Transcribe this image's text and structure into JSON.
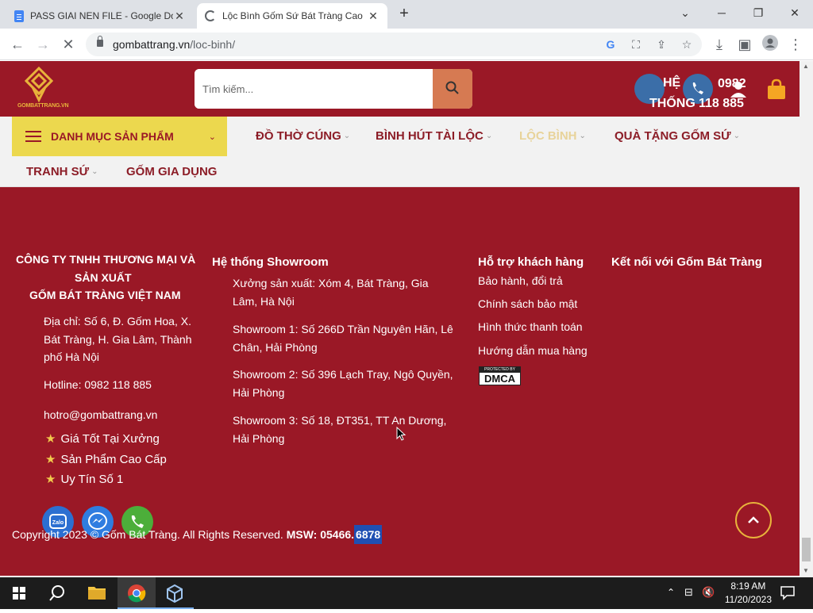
{
  "browser": {
    "tabs": [
      {
        "title": "PASS GIAI NEN FILE - Google Do"
      },
      {
        "title": "Lộc Bình Gốm Sứ Bát Tràng Cao"
      }
    ],
    "url_host": "gombattrang.vn",
    "url_path": "/loc-binh/"
  },
  "header": {
    "logo_text": "GOMBATTRANG.VN",
    "search_placeholder": "Tìm kiếm...",
    "he_label": "HỆ",
    "thong_label": "THỐNG",
    "phone_part1": "0982",
    "phone_part2": "118 885",
    "ghost_label": "HỆ\nTHỐNG"
  },
  "menu": {
    "category_button": "DANH MỤC SẢN PHẨM",
    "items": [
      {
        "label": "ĐỒ THỜ CÚNG"
      },
      {
        "label": "BÌNH HÚT TÀI LỘC"
      },
      {
        "label": "LỘC BÌNH"
      },
      {
        "label": "QUÀ TẶNG GỐM SỨ"
      },
      {
        "label": "TRANH SỨ"
      },
      {
        "label": "GỐM GIA DỤNG"
      }
    ]
  },
  "footer": {
    "company_line1": "CÔNG TY TNHH THƯƠNG MẠI VÀ",
    "company_line2": "SẢN XUẤT",
    "company_line3": "GỐM BÁT TRÀNG VIỆT NAM",
    "address": "Địa chỉ: Số 6, Đ. Gốm Hoa, X. Bát Tràng, H. Gia Lâm, Thành phố Hà Nội",
    "hotline": "Hotline: 0982 118 885",
    "email": "hotro@gombattrang.vn",
    "badges": [
      "Giá Tốt Tại Xưởng",
      "Sản Phẩm Cao Cấp",
      "Uy Tín Số 1"
    ],
    "showroom_title": "Hệ thống Showroom",
    "showrooms": [
      "Xưởng sản xuất: Xóm 4, Bát Tràng, Gia Lâm, Hà Nội",
      "Showroom 1: Số 266D Trần Nguyên Hãn, Lê Chân, Hải Phòng",
      "Showroom 2: Số 396 Lạch Tray, Ngô Quyền, Hải Phòng",
      "Showroom 3: Số 18, ĐT351, TT An Dương, Hải Phòng"
    ],
    "support_title": "Hỗ trợ khách hàng",
    "support_links": [
      "Bảo hành, đổi trả",
      "Chính sách bảo mật",
      "Hình thức thanh toán",
      "Hướng dẫn mua hàng"
    ],
    "dmca_top": "PROTECTED BY",
    "dmca_label": "DMCA",
    "connect_title": "Kết nối với Gốm Bát Tràng",
    "copyright_prefix": "Copyright 2023 © Gốm Bát Tràng. All Rights Reserved.",
    "msw_label": "MSW: 05466.",
    "msw_highlight": "6878",
    "zalo_label": "Zalo"
  },
  "taskbar": {
    "time": "8:19 AM",
    "date": "11/20/2023"
  },
  "colors": {
    "brand_red": "#9a1826",
    "accent_yellow": "#ecd84e",
    "gold": "#e8b33b"
  }
}
